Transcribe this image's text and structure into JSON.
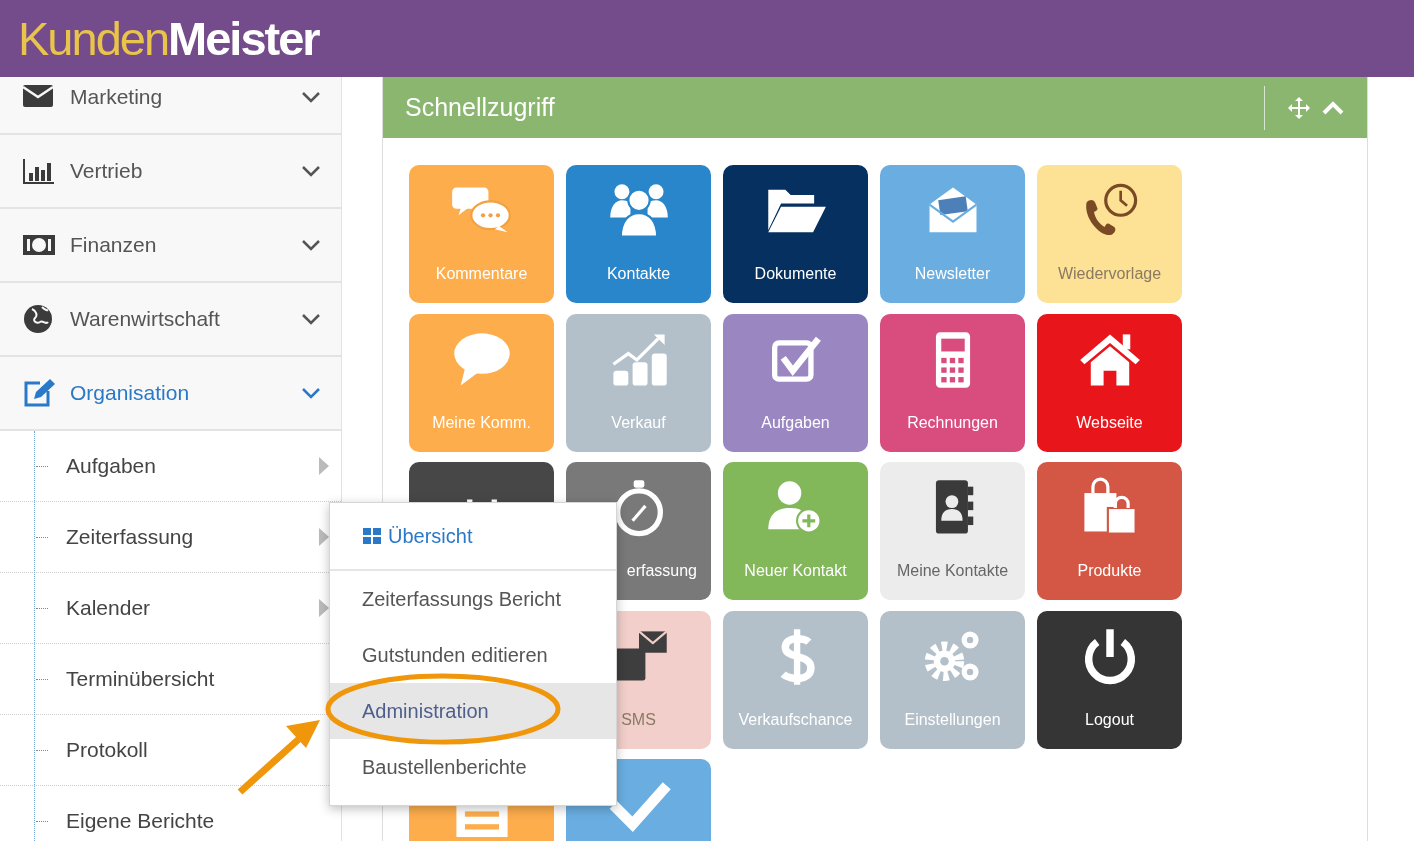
{
  "header": {
    "brand": "Kunden",
    "brand_accent": "Meister"
  },
  "sidebar": {
    "items": [
      {
        "label": "Marketing",
        "expanded": false
      },
      {
        "label": "Vertrieb",
        "expanded": false
      },
      {
        "label": "Finanzen",
        "expanded": false
      },
      {
        "label": "Warenwirtschaft",
        "expanded": false
      },
      {
        "label": "Organisation",
        "expanded": true,
        "children": [
          {
            "label": "Aufgaben",
            "has_submenu": true
          },
          {
            "label": "Zeiterfassung",
            "has_submenu": true
          },
          {
            "label": "Kalender",
            "has_submenu": true
          },
          {
            "label": "Terminübersicht",
            "has_submenu": false
          },
          {
            "label": "Protokoll",
            "has_submenu": false
          },
          {
            "label": "Eigene Berichte",
            "has_submenu": false
          }
        ]
      }
    ]
  },
  "panel": {
    "title": "Schnellzugriff",
    "tiles": [
      {
        "kind": "tile",
        "label": "Kommentare",
        "color": "#fdad4c"
      },
      {
        "kind": "tile",
        "label": "Kontakte",
        "color": "#2986cb"
      },
      {
        "kind": "tile",
        "label": "Dokumente",
        "color": "#05305f"
      },
      {
        "kind": "tile",
        "label": "Newsletter",
        "color": "#6aaee1"
      },
      {
        "kind": "tile",
        "label": "Wiedervorlage",
        "color": "#fde194"
      },
      {
        "kind": "tile",
        "label": "Meine Komm.",
        "color": "#fdad4c"
      },
      {
        "kind": "tile",
        "label": "Verkauf",
        "color": "#b3c0ca"
      },
      {
        "kind": "tile",
        "label": "Aufgaben",
        "color": "#9a87c1"
      },
      {
        "kind": "tile",
        "label": "Rechnungen",
        "color": "#d94c7e"
      },
      {
        "kind": "tile",
        "label": "Webseite",
        "color": "#e8161a"
      },
      {
        "kind": "tile",
        "color": "#474747"
      },
      {
        "kind": "tile",
        "label": "erfassung",
        "color": "#797979"
      },
      {
        "kind": "tile",
        "label": "Neuer Kontakt",
        "color": "#82b75a"
      },
      {
        "kind": "tile",
        "label": "Meine Kontakte",
        "color": "#ececec"
      },
      {
        "kind": "tile",
        "label": "Produkte",
        "color": "#d35744"
      },
      {
        "kind": "covered"
      },
      {
        "kind": "tile",
        "label": "SMS",
        "color": "#f2cfca"
      },
      {
        "kind": "tile",
        "label": "Verkaufschance",
        "color": "#b3c0ca"
      },
      {
        "kind": "tile",
        "label": "Einstellungen",
        "color": "#b3c0ca"
      },
      {
        "kind": "tile",
        "label": "Logout",
        "color": "#353535"
      },
      {
        "kind": "tile",
        "color": "#fdad4c"
      },
      {
        "kind": "tile",
        "color": "#6aaee1"
      }
    ]
  },
  "submenu": {
    "items": [
      {
        "label": "Übersicht",
        "kind": "overview",
        "selected": false
      },
      {
        "label": "Zeiterfassungs Bericht",
        "kind": "link",
        "selected": false
      },
      {
        "label": "Gutstunden editieren",
        "kind": "link",
        "selected": false
      },
      {
        "label": "Administration",
        "kind": "link",
        "selected": true
      },
      {
        "label": "Baustellenberichte",
        "kind": "link",
        "selected": false
      }
    ]
  }
}
